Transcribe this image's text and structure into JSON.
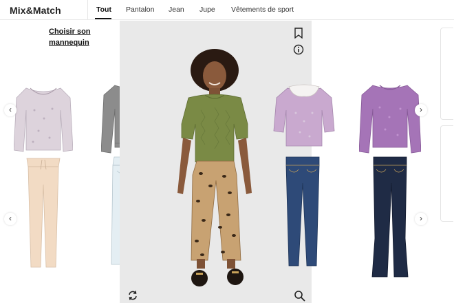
{
  "app": {
    "brand": "Mix&Match"
  },
  "tabs": [
    {
      "label": "Tout",
      "active": true
    },
    {
      "label": "Pantalon",
      "active": false
    },
    {
      "label": "Jean",
      "active": false
    },
    {
      "label": "Jupe",
      "active": false
    },
    {
      "label": "Vêtements de sport",
      "active": false
    }
  ],
  "mannequin": {
    "line1": "Choisir son",
    "line2": "mannequin"
  },
  "arrows": {
    "prev": "‹",
    "next": "›"
  },
  "colors": {
    "stage_bg": "#e9e9e9",
    "sweater_green": "#7a8a45",
    "sweater_grey": "#8c8c8c",
    "sweater_lilac": "#c9a9cf",
    "sweater_purple": "#a574b7",
    "denim_blue": "#2e4a78",
    "denim_dark": "#1f2b45",
    "cream_pant": "#f2dbc4",
    "light_denim": "#e4eef3"
  },
  "icons": {
    "bookmark": "bookmark-icon",
    "info": "info-icon",
    "refresh": "refresh-icon",
    "zoom": "zoom-icon"
  }
}
